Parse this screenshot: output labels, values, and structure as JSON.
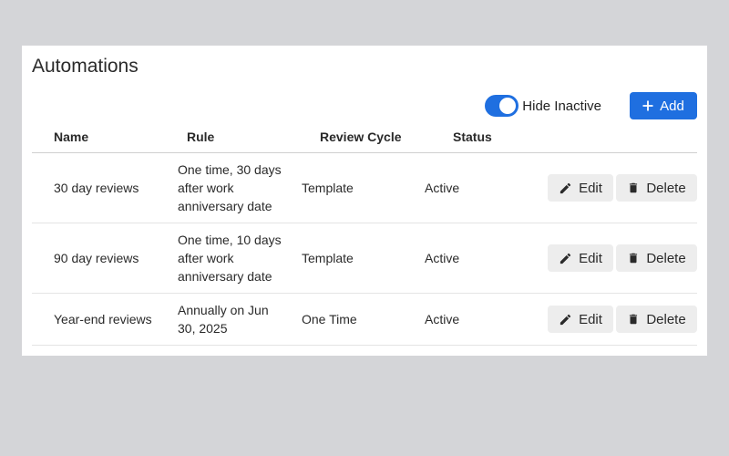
{
  "page": {
    "title": "Automations"
  },
  "toolbar": {
    "hide_inactive_label": "Hide Inactive",
    "hide_inactive_on": true,
    "add_label": "Add"
  },
  "table": {
    "headers": [
      "Name",
      "Rule",
      "Review Cycle",
      "Status"
    ],
    "rows": [
      {
        "name": "30 day reviews",
        "rule": "One time, 30 days after work anniversary date",
        "cycle": "Template",
        "status": "Active",
        "edit_label": "Edit",
        "delete_label": "Delete"
      },
      {
        "name": "90 day reviews",
        "rule": "One time, 10 days after work anniversary date",
        "cycle": "Template",
        "status": "Active",
        "edit_label": "Edit",
        "delete_label": "Delete"
      },
      {
        "name": "Year-end reviews",
        "rule": "Annually on Jun 30, 2025",
        "cycle": "One Time",
        "status": "Active",
        "edit_label": "Edit",
        "delete_label": "Delete"
      }
    ]
  },
  "colors": {
    "accent": "#1f6fe0",
    "background": "#d4d5d8",
    "button_secondary": "#ededed"
  },
  "icons": {
    "add": "plus-icon",
    "edit": "pencil-icon",
    "delete": "trash-icon"
  }
}
